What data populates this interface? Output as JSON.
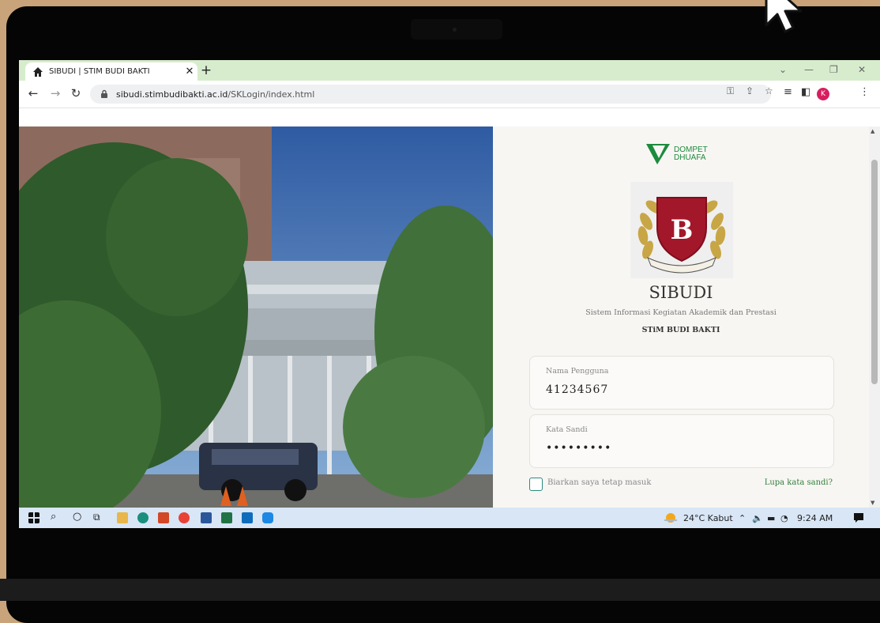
{
  "browser": {
    "tab_title": "SIBUDI | STIM BUDI BAKTI",
    "url_host": "sibudi.stimbudibakti.ac.id",
    "url_path": "/SKLogin/index.html",
    "profile_initial": "K"
  },
  "login": {
    "partner_logo_text_1": "DOMPET",
    "partner_logo_text_2": "DHUAFA",
    "crest_text": "STIM BUDI BAKTI",
    "app_title": "SIBUDI",
    "app_subtitle": "Sistem Informasi Kegiatan Akademik dan Prestasi",
    "org_name": "STiM BUDI BAKTI",
    "username_label": "Nama Pengguna",
    "username_value": "41234567",
    "password_label": "Kata Sandi",
    "password_value": "•••••••••",
    "remember_label": "Biarkan saya tetap masuk",
    "forgot_link": "Lupa kata sandi?"
  },
  "taskbar": {
    "weather": "24°C  Kabut",
    "time": "9:24 AM"
  },
  "colors": {
    "tab_bar": "#d7eccd",
    "brand_green": "#1c8b3d",
    "crest_red": "#a3172a",
    "link_green": "#2f7f3a",
    "avatar": "#d61f5f"
  }
}
